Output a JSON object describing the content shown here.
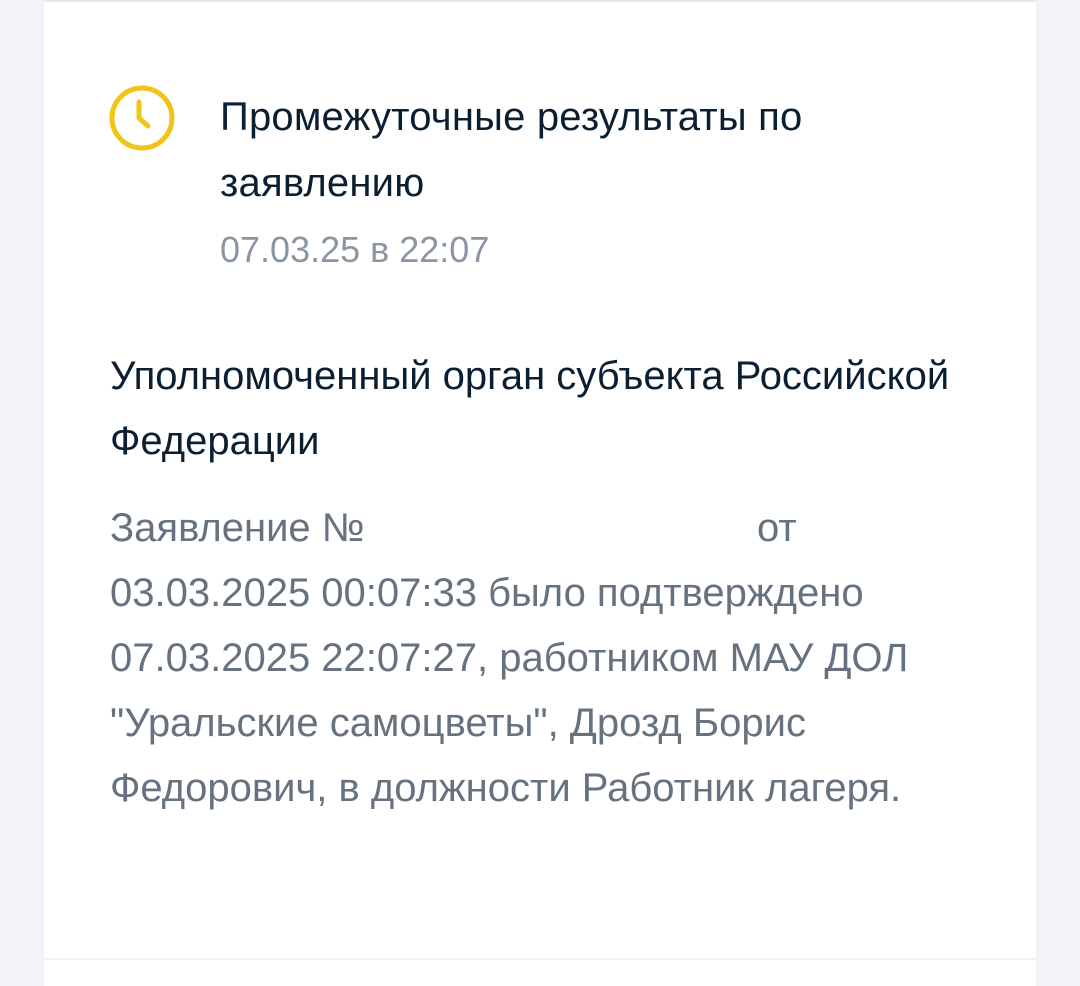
{
  "event": {
    "icon": "clock-icon",
    "accent_color": "#f0c419",
    "title": "Промежуточные результаты по заявлению",
    "date": "07.03.25 в 22:07"
  },
  "details": {
    "organization": "Уполномоченный орган субъекта Российской Федерации",
    "prefix": "Заявление №",
    "text_after_number": "от 03.03.2025 00:07:33 было подтверждено 07.03.2025 22:07:27, работником МАУ ДОЛ \"Уральские самоцветы\", Дрозд Борис Федорович, в должности Работник лагеря."
  }
}
